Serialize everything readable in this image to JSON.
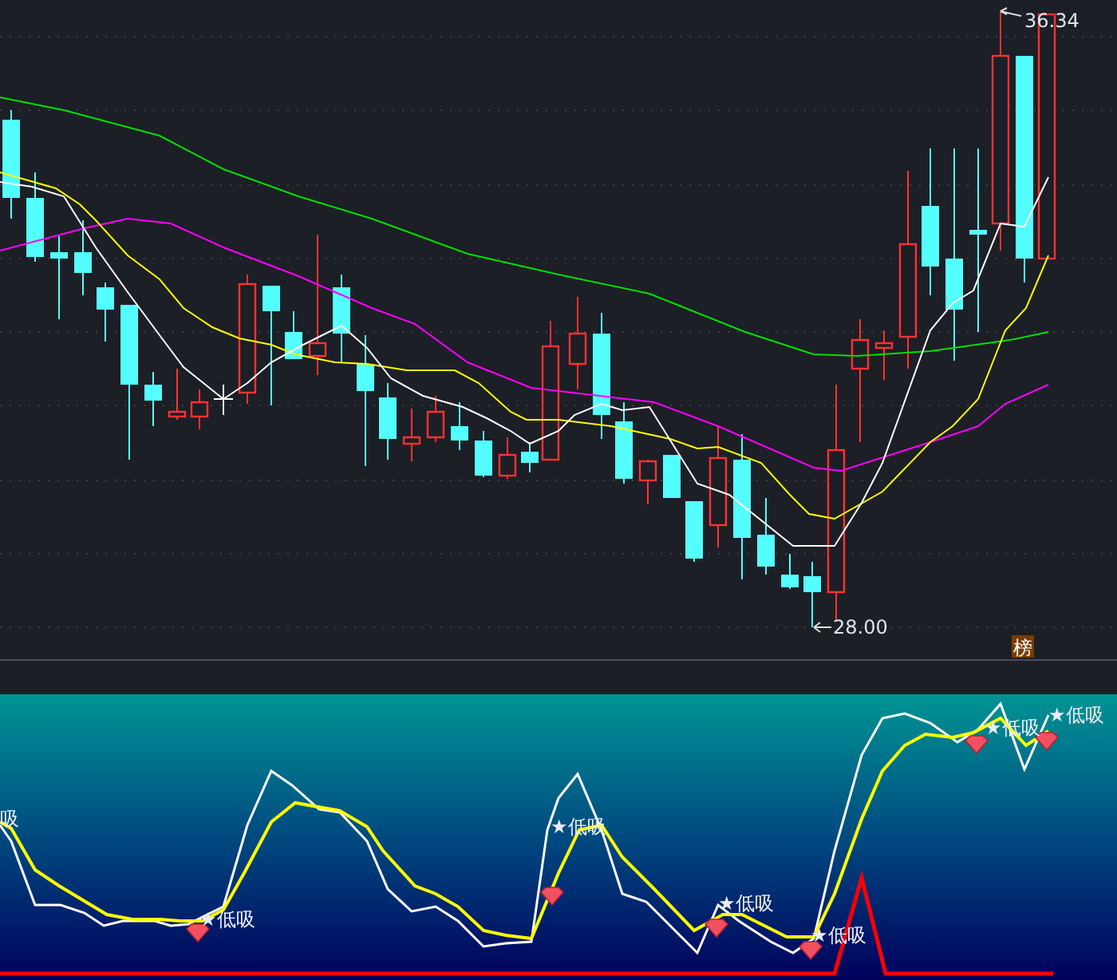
{
  "price_chart": {
    "high_label": "36.34",
    "low_label": "28.00",
    "badge": "榜"
  },
  "indicator_panel": {
    "signals": [
      {
        "text": "吸"
      },
      {
        "text": "★低吸"
      },
      {
        "text": "★低吸"
      },
      {
        "text": "★低吸"
      },
      {
        "text": "★低吸"
      },
      {
        "text": "★低吸"
      },
      {
        "text": "★低吸"
      }
    ]
  }
}
